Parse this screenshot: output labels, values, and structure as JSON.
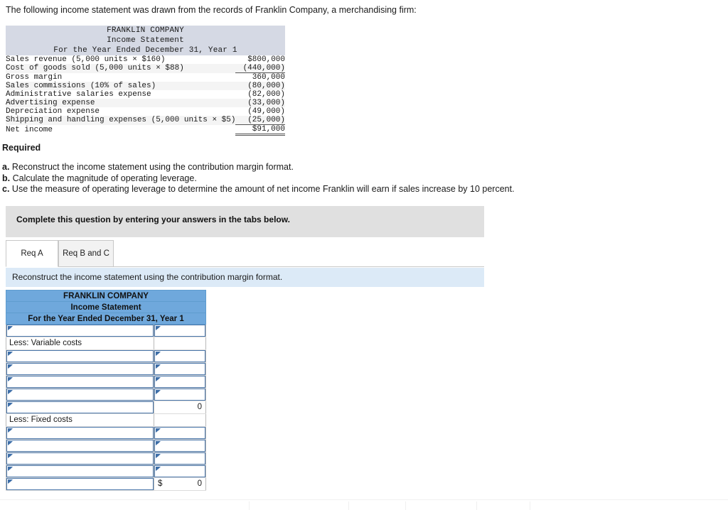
{
  "intro": "The following income statement was drawn from the records of Franklin Company, a merchandising firm:",
  "given_statement": {
    "header": [
      "FRANKLIN COMPANY",
      "Income Statement",
      "For the Year Ended December 31, Year 1"
    ],
    "rows": [
      {
        "label": "Sales revenue (5,000 units × $160)",
        "amount": "$800,000",
        "rule": "none"
      },
      {
        "label": "Cost of goods sold (5,000 units × $88)",
        "amount": "(440,000)",
        "rule": "under"
      },
      {
        "label": "Gross margin",
        "amount": "360,000",
        "rule": "none"
      },
      {
        "label": "Sales commissions (10% of sales)",
        "amount": "(80,000)",
        "rule": "none"
      },
      {
        "label": "Administrative salaries expense",
        "amount": "(82,000)",
        "rule": "none"
      },
      {
        "label": "Advertising expense",
        "amount": "(33,000)",
        "rule": "none"
      },
      {
        "label": "Depreciation expense",
        "amount": "(49,000)",
        "rule": "none"
      },
      {
        "label": "Shipping and handling expenses (5,000 units × $5)",
        "amount": "(25,000)",
        "rule": "under"
      },
      {
        "label": "Net income",
        "amount": "$91,000",
        "rule": "double"
      }
    ]
  },
  "required": {
    "heading": "Required",
    "items": [
      {
        "marker": "a.",
        "text": "Reconstruct the income statement using the contribution margin format."
      },
      {
        "marker": "b.",
        "text": "Calculate the magnitude of operating leverage."
      },
      {
        "marker": "c.",
        "text": "Use the measure of operating leverage to determine the amount of net income Franklin will earn if sales increase by 10 percent."
      }
    ]
  },
  "banner": {
    "text": "Complete this question by entering your answers in the tabs below."
  },
  "tabs": [
    {
      "label": "Req A",
      "active": true
    },
    {
      "label": "Req B and C",
      "active": false
    }
  ],
  "instruction": "Reconstruct the income statement using the contribution margin format.",
  "answer_table": {
    "header": [
      "FRANKLIN COMPANY",
      "Income Statement",
      "For the Year Ended December 31, Year 1"
    ],
    "rows": [
      {
        "type": "input",
        "label": "",
        "value": "",
        "value_type": "input",
        "topline": false
      },
      {
        "type": "static",
        "label": "Less: Variable costs",
        "value": "",
        "value_type": "blank",
        "topline": false
      },
      {
        "type": "input",
        "label": "",
        "value": "",
        "value_type": "input",
        "topline": false
      },
      {
        "type": "input",
        "label": "",
        "value": "",
        "value_type": "input",
        "topline": false
      },
      {
        "type": "input",
        "label": "",
        "value": "",
        "value_type": "input",
        "topline": false
      },
      {
        "type": "input",
        "label": "",
        "value": "",
        "value_type": "input",
        "topline": false
      },
      {
        "type": "input",
        "label": "",
        "value": "0",
        "value_type": "number",
        "topline": true
      },
      {
        "type": "static",
        "label": "Less: Fixed costs",
        "value": "",
        "value_type": "blank",
        "topline": false
      },
      {
        "type": "input",
        "label": "",
        "value": "",
        "value_type": "input",
        "topline": false
      },
      {
        "type": "input",
        "label": "",
        "value": "",
        "value_type": "input",
        "topline": false
      },
      {
        "type": "input",
        "label": "",
        "value": "",
        "value_type": "input",
        "topline": false
      },
      {
        "type": "input",
        "label": "",
        "value": "",
        "value_type": "input",
        "topline": false
      },
      {
        "type": "input",
        "label": "",
        "value": "0",
        "value_type": "money",
        "currency": "$",
        "topline": true
      }
    ]
  },
  "colors": {
    "answer_header_blue": "#6fa8dc",
    "instruction_blue": "#dceaf7",
    "banner_grey": "#e0e0e0",
    "given_header_grey": "#d5d9e4",
    "input_border_blue": "#4a77ab"
  }
}
